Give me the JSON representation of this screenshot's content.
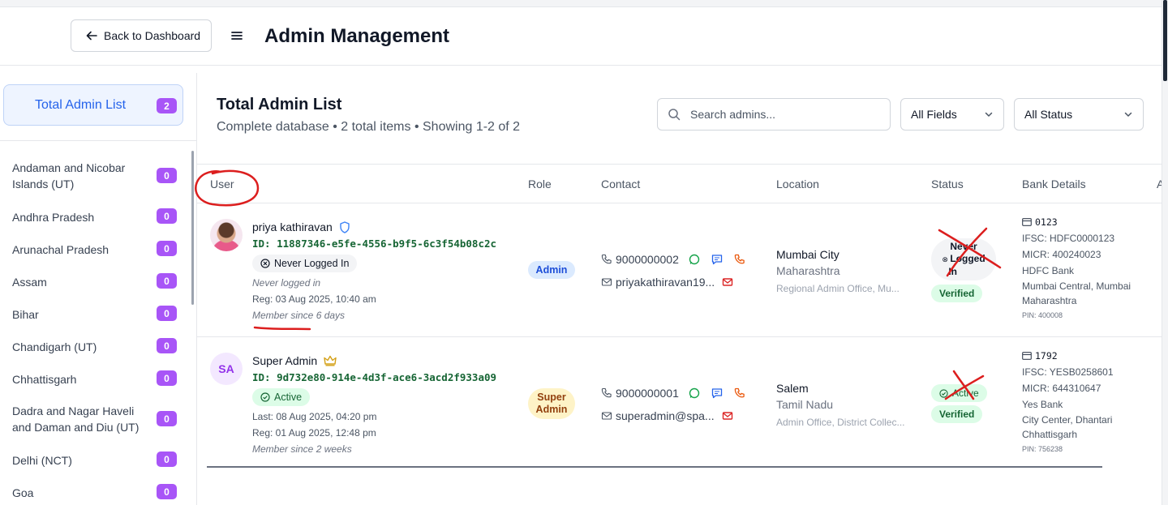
{
  "header": {
    "back_label": "Back to Dashboard",
    "title": "Admin Management"
  },
  "sidebar": {
    "total": {
      "label": "Total Admin List",
      "count": "2"
    },
    "states": [
      {
        "name": "Andaman and Nicobar Islands (UT)",
        "count": "0"
      },
      {
        "name": "Andhra Pradesh",
        "count": "0"
      },
      {
        "name": "Arunachal Pradesh",
        "count": "0"
      },
      {
        "name": "Assam",
        "count": "0"
      },
      {
        "name": "Bihar",
        "count": "0"
      },
      {
        "name": "Chandigarh (UT)",
        "count": "0"
      },
      {
        "name": "Chhattisgarh",
        "count": "0"
      },
      {
        "name": "Dadra and Nagar Haveli and Daman and Diu (UT)",
        "count": "0"
      },
      {
        "name": "Delhi (NCT)",
        "count": "0"
      },
      {
        "name": "Goa",
        "count": "0"
      }
    ]
  },
  "main": {
    "title": "Total Admin List",
    "subtitle": "Complete database • 2 total items • Showing 1-2 of 2",
    "search_placeholder": "Search admins...",
    "filter_fields": "All Fields",
    "filter_status": "All Status"
  },
  "table": {
    "columns": [
      "User",
      "Role",
      "Contact",
      "Location",
      "Status",
      "Bank Details",
      "A"
    ],
    "rows": [
      {
        "avatar": "photo",
        "name": "priya kathiravan",
        "name_icon": "shield-icon",
        "id": "ID: 11887346-e5fe-4556-b9f5-6c3f54b08c2c",
        "login_status": "Never Logged In",
        "last": "Never logged in",
        "reg": "Reg: 03 Aug 2025, 10:40 am",
        "member_since": "Member since 6 days",
        "role": "Admin",
        "phone": "9000000002",
        "email": "priyakathiravan19...",
        "city": "Mumbai City",
        "state": "Maharashtra",
        "office": "Regional Admin Office, Mu...",
        "status_line1": "Never",
        "status_line2": "Logged",
        "status_line3": "In",
        "verified": "Verified",
        "bank_acc": "0123",
        "ifsc": "IFSC: HDFC0000123",
        "micr": "MICR: 400240023",
        "bank_name": "HDFC Bank",
        "branch1": "Mumbai Central, Mumbai",
        "branch2": "Maharashtra",
        "pin": "PIN: 400008"
      },
      {
        "avatar": "SA",
        "name": "Super Admin",
        "name_icon": "crown-icon",
        "id": "ID: 9d732e80-914e-4d3f-ace6-3acd2f933a09",
        "login_status": "Active",
        "last": "Last: 08 Aug 2025, 04:20 pm",
        "reg": "Reg: 01 Aug 2025, 12:48 pm",
        "member_since": "Member since 2 weeks",
        "role_line1": "Super",
        "role_line2": "Admin",
        "phone": "9000000001",
        "email": "superadmin@spa...",
        "city": "Salem",
        "state": "Tamil Nadu",
        "office": "Admin Office, District Collec...",
        "status": "Active",
        "verified": "Verified",
        "bank_acc": "1792",
        "ifsc": "IFSC: YESB0258601",
        "micr": "MICR: 644310647",
        "bank_name": "Yes Bank",
        "branch1": "City Center, Dhantari",
        "branch2": "Chhattisgarh",
        "pin": "PIN: 756238"
      }
    ]
  },
  "colors": {
    "accent_blue": "#2563eb",
    "badge_purple": "#a855f7",
    "id_green": "#166534",
    "annotation_red": "#dc1e1e"
  }
}
